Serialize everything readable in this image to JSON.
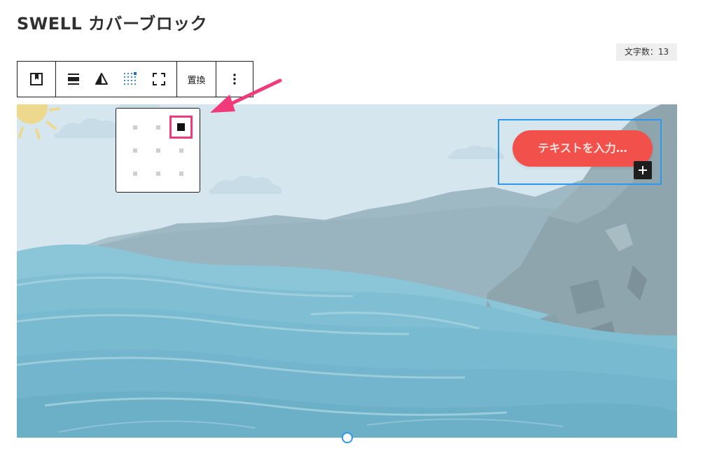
{
  "page": {
    "title": "SWELL カバーブロック",
    "char_count": "文字数：13"
  },
  "toolbar": {
    "items": [
      {
        "icon": "bookmark-block-icon",
        "label": ""
      },
      {
        "icon": "align-full-width-icon",
        "label": ""
      },
      {
        "icon": "contrast-duotone-icon",
        "label": ""
      },
      {
        "icon": "content-position-grid-icon",
        "label": ""
      },
      {
        "icon": "fullscreen-frame-icon",
        "label": ""
      },
      {
        "icon": "",
        "label": "置換"
      },
      {
        "icon": "more-options-vertical-icon",
        "label": ""
      }
    ],
    "replace_label": "置換"
  },
  "position_picker": {
    "positions": [
      "top-left",
      "top-center",
      "top-right",
      "center-left",
      "center-center",
      "center-right",
      "bottom-left",
      "bottom-center",
      "bottom-right"
    ],
    "selected": "top-right"
  },
  "cover": {
    "button_placeholder": "テキストを入力…",
    "add_block_icon": "plus-icon",
    "colors": {
      "sky": "#d6e6ee",
      "sea": "#7fc1d6",
      "mountains": "#9db8c3",
      "cliff": "#8fa6af",
      "button": "#f2504b",
      "selection": "#2f96f3",
      "annotation": "#f03a7a"
    }
  }
}
